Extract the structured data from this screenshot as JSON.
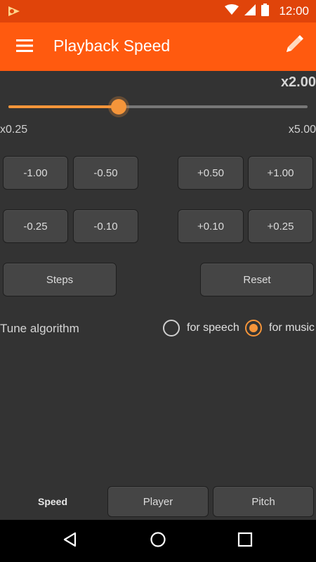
{
  "status_bar": {
    "time": "12:00"
  },
  "app_bar": {
    "title": "Playback Speed"
  },
  "speed": {
    "display": "x2.00",
    "min_label": "x0.25",
    "max_label": "x5.00",
    "current": 2.0,
    "min": 0.25,
    "max": 5.0
  },
  "step_buttons": {
    "row1": {
      "minus_large": "-1.00",
      "minus_small": "-0.50",
      "plus_small": "+0.50",
      "plus_large": "+1.00"
    },
    "row2": {
      "minus_large": "-0.25",
      "minus_small": "-0.10",
      "plus_small": "+0.10",
      "plus_large": "+0.25"
    }
  },
  "actions": {
    "steps": "Steps",
    "reset": "Reset"
  },
  "tune_algorithm": {
    "label": "Tune algorithm",
    "options": [
      {
        "label": "for speech",
        "selected": false
      },
      {
        "label": "for music",
        "selected": true
      }
    ]
  },
  "tabs": {
    "speed": "Speed",
    "player": "Player",
    "pitch": "Pitch"
  },
  "colors": {
    "accent": "#f5953a",
    "app_bar": "#ff5a0f",
    "status_bar": "#e0440a",
    "background": "#333333"
  },
  "icons": {
    "menu": "hamburger-menu-icon",
    "edit": "pencil-icon",
    "wifi": "wifi-icon",
    "signal": "cell-signal-icon",
    "battery": "battery-icon",
    "back": "nav-back-icon",
    "home": "nav-home-icon",
    "recents": "nav-recents-icon"
  }
}
